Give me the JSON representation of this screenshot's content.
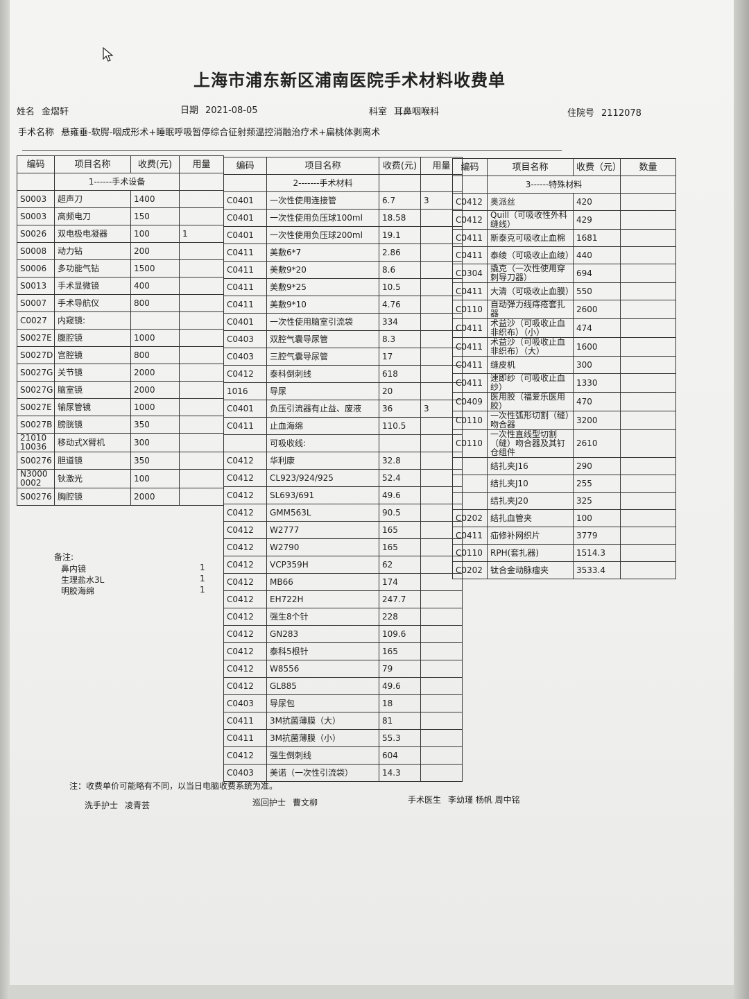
{
  "form": {
    "title": "上海市浦东新区浦南医院手术材料收费单",
    "name_label": "姓名",
    "name_value": "金熠轩",
    "date_label": "日期",
    "date_value": "2021-08-05",
    "dept_label": "科室",
    "dept_value": "耳鼻咽喉科",
    "inpatient_label": "住院号",
    "inpatient_value": "2112078",
    "surgery_label": "手术名称",
    "surgery_value": "悬雍垂-软腭-咽成形术+睡眠呼吸暂停综合征射频温控消融治疗术+扁桃体剥离术"
  },
  "headers": {
    "left": [
      "编码",
      "项目名称",
      "收费(元)",
      "用量"
    ],
    "mid": [
      "编码",
      "项目名称",
      "收费(元)",
      "用量"
    ],
    "right": [
      "编码",
      "项目名称",
      "收费（元）",
      "数量"
    ]
  },
  "sections": {
    "equipment": "1------手术设备",
    "materials": "2-------手术材料",
    "special": "3------特殊材料"
  },
  "equipment": [
    {
      "code": "S0003",
      "name": "超声刀",
      "fee": "1400",
      "qty": ""
    },
    {
      "code": "S0003",
      "name": "高频电刀",
      "fee": "150",
      "qty": ""
    },
    {
      "code": "S0026",
      "name": "双电极电凝器",
      "fee": "100",
      "qty": "1"
    },
    {
      "code": "S0008",
      "name": "动力钻",
      "fee": "200",
      "qty": ""
    },
    {
      "code": "S0006",
      "name": "多功能气钻",
      "fee": "1500",
      "qty": ""
    },
    {
      "code": "S0013",
      "name": "手术显微镜",
      "fee": "400",
      "qty": ""
    },
    {
      "code": "S0007",
      "name": "手术导航仪",
      "fee": "800",
      "qty": ""
    },
    {
      "code": "C0027",
      "name": "内窥镜:",
      "fee": "",
      "qty": ""
    },
    {
      "code": "S0027E",
      "name": "腹腔镜",
      "fee": "1000",
      "qty": ""
    },
    {
      "code": "S0027D",
      "name": "宫腔镜",
      "fee": "800",
      "qty": ""
    },
    {
      "code": "S0027G",
      "name": "关节镜",
      "fee": "2000",
      "qty": ""
    },
    {
      "code": "S0027G",
      "name": "脑室镜",
      "fee": "2000",
      "qty": ""
    },
    {
      "code": "S0027E",
      "name": "输尿管镜",
      "fee": "1000",
      "qty": ""
    },
    {
      "code": "S0027B",
      "name": "膀胱镜",
      "fee": "350",
      "qty": ""
    },
    {
      "code": "21010 10036",
      "name": "移动式X臂机",
      "fee": "300",
      "qty": ""
    },
    {
      "code": "S00276",
      "name": "胆道镜",
      "fee": "350",
      "qty": ""
    },
    {
      "code": "N3000 0002",
      "name": "钬激光",
      "fee": "100",
      "qty": ""
    },
    {
      "code": "S00276",
      "name": "胸腔镜",
      "fee": "2000",
      "qty": ""
    }
  ],
  "materials": [
    {
      "code": "C0401",
      "name": "一次性使用连接管",
      "fee": "6.7",
      "qty": "3"
    },
    {
      "code": "C0401",
      "name": "一次性使用负压球100ml",
      "fee": "18.58",
      "qty": ""
    },
    {
      "code": "C0401",
      "name": "一次性使用负压球200ml",
      "fee": "19.1",
      "qty": ""
    },
    {
      "code": "C0411",
      "name": "美敷6*7",
      "fee": "2.86",
      "qty": ""
    },
    {
      "code": "C0411",
      "name": "美敷9*20",
      "fee": "8.6",
      "qty": ""
    },
    {
      "code": "C0411",
      "name": "美敷9*25",
      "fee": "10.5",
      "qty": ""
    },
    {
      "code": "C0411",
      "name": "美敷9*10",
      "fee": "4.76",
      "qty": ""
    },
    {
      "code": "C0401",
      "name": "一次性使用脑室引流袋",
      "fee": "334",
      "qty": ""
    },
    {
      "code": "C0403",
      "name": "双腔气囊导尿管",
      "fee": "8.3",
      "qty": ""
    },
    {
      "code": "C0403",
      "name": "三腔气囊导尿管",
      "fee": "17",
      "qty": ""
    },
    {
      "code": "C0412",
      "name": "泰科倒刺线",
      "fee": "618",
      "qty": ""
    },
    {
      "code": "1016",
      "name": "导尿",
      "fee": "20",
      "qty": ""
    },
    {
      "code": "C0401",
      "name": "负压引流器有止益、废液",
      "fee": "36",
      "qty": "3"
    },
    {
      "code": "C0411",
      "name": "止血海绵",
      "fee": "110.5",
      "qty": ""
    },
    {
      "code": "",
      "name": "可吸收线:",
      "fee": "",
      "qty": ""
    },
    {
      "code": "C0412",
      "name": "华利康",
      "fee": "32.8",
      "qty": ""
    },
    {
      "code": "C0412",
      "name": "CL923/924/925",
      "fee": "52.4",
      "qty": ""
    },
    {
      "code": "C0412",
      "name": "SL693/691",
      "fee": "49.6",
      "qty": ""
    },
    {
      "code": "C0412",
      "name": "GMM563L",
      "fee": "90.5",
      "qty": ""
    },
    {
      "code": "C0412",
      "name": "W2777",
      "fee": "165",
      "qty": ""
    },
    {
      "code": "C0412",
      "name": "W2790",
      "fee": "165",
      "qty": ""
    },
    {
      "code": "C0412",
      "name": "VCP359H",
      "fee": "62",
      "qty": ""
    },
    {
      "code": "C0412",
      "name": "MB66",
      "fee": "174",
      "qty": ""
    },
    {
      "code": "C0412",
      "name": "EH722H",
      "fee": "247.7",
      "qty": ""
    },
    {
      "code": "C0412",
      "name": "强生8个针",
      "fee": "228",
      "qty": ""
    },
    {
      "code": "C0412",
      "name": "GN283",
      "fee": "109.6",
      "qty": ""
    },
    {
      "code": "C0412",
      "name": "泰科5根针",
      "fee": "165",
      "qty": ""
    },
    {
      "code": "C0412",
      "name": "W8556",
      "fee": "79",
      "qty": ""
    },
    {
      "code": "C0412",
      "name": "GL885",
      "fee": "49.6",
      "qty": ""
    },
    {
      "code": "C0403",
      "name": "导尿包",
      "fee": "18",
      "qty": ""
    },
    {
      "code": "C0411",
      "name": "3M抗菌薄膜（大）",
      "fee": "81",
      "qty": ""
    },
    {
      "code": "C0411",
      "name": "3M抗菌薄膜（小）",
      "fee": "55.3",
      "qty": ""
    },
    {
      "code": "C0412",
      "name": "强生倒刺线",
      "fee": "604",
      "qty": ""
    },
    {
      "code": "C0403",
      "name": "美诺（一次性引流袋）",
      "fee": "14.3",
      "qty": ""
    }
  ],
  "special": [
    {
      "code": "C0412",
      "name": "奥派丝",
      "fee": "420",
      "qty": ""
    },
    {
      "code": "C0412",
      "name": "Quill（可吸收性外科缝线）",
      "fee": "429",
      "qty": ""
    },
    {
      "code": "C0411",
      "name": "斯泰克可吸收止血棉",
      "fee": "1681",
      "qty": ""
    },
    {
      "code": "C0411",
      "name": "泰绫（可吸收止血绫）",
      "fee": "440",
      "qty": ""
    },
    {
      "code": "C0304",
      "name": "撬克（一次性使用穿刺导刀器）",
      "fee": "694",
      "qty": ""
    },
    {
      "code": "C0411",
      "name": "大清（可吸收止血膜）",
      "fee": "550",
      "qty": ""
    },
    {
      "code": "C0110",
      "name": "自动弹力线痔疮套扎器",
      "fee": "2600",
      "qty": ""
    },
    {
      "code": "C0411",
      "name": "术益沙（可吸收止血非织布）（小）",
      "fee": "474",
      "qty": ""
    },
    {
      "code": "C0411",
      "name": "术益沙（可吸收止血非织布）（大）",
      "fee": "1600",
      "qty": ""
    },
    {
      "code": "C0411",
      "name": "缝皮机",
      "fee": "300",
      "qty": ""
    },
    {
      "code": "C0411",
      "name": "速即纱（可吸收止血纱）",
      "fee": "1330",
      "qty": ""
    },
    {
      "code": "C0409",
      "name": "医用胶（福爱乐医用胶）",
      "fee": "470",
      "qty": ""
    },
    {
      "code": "C0110",
      "name": "一次性弧形切割（缝）吻合器",
      "fee": "3200",
      "qty": ""
    },
    {
      "code": "C0110",
      "name": "一次性直线型切割（缝）吻合器及其钉仓组件",
      "fee": "2610",
      "qty": ""
    },
    {
      "code": "",
      "name": "结扎夹J16",
      "fee": "290",
      "qty": ""
    },
    {
      "code": "",
      "name": "结扎夹J10",
      "fee": "255",
      "qty": ""
    },
    {
      "code": "",
      "name": "结扎夹J20",
      "fee": "325",
      "qty": ""
    },
    {
      "code": "C0202",
      "name": "结扎血管夹",
      "fee": "100",
      "qty": ""
    },
    {
      "code": "C0411",
      "name": "疝修补网织片",
      "fee": "3779",
      "qty": ""
    },
    {
      "code": "C0110",
      "name": "RPH(套扎器)",
      "fee": "1514.3",
      "qty": ""
    },
    {
      "code": "C0202",
      "name": "钛合金动脉瘤夹",
      "fee": "3533.4",
      "qty": ""
    }
  ],
  "remarks": {
    "label": "备注:",
    "items": [
      {
        "name": "鼻内镜",
        "qty": "1"
      },
      {
        "name": "生理盐水3L",
        "qty": "1"
      },
      {
        "name": "明胶海绵",
        "qty": "1"
      }
    ]
  },
  "footer": {
    "note": "注：收费单价可能略有不同，以当日电脑收费系统为准。",
    "scrub_nurse_label": "洗手护士",
    "scrub_nurse": "凌青芸",
    "circ_nurse_label": "巡回护士",
    "circ_nurse": "曹文柳",
    "surgeon_label": "手术医生",
    "surgeons": "李幼瑾  杨帆  周中铭"
  }
}
